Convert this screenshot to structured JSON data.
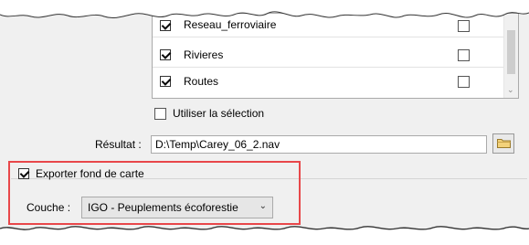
{
  "layers": {
    "items": [
      {
        "label": "Reseau_ferroviaire",
        "visible": true,
        "extra": false
      },
      {
        "label": "Rivieres",
        "visible": true,
        "extra": false
      },
      {
        "label": "Routes",
        "visible": true,
        "extra": false
      }
    ]
  },
  "use_selection": {
    "label": "Utiliser la sélection",
    "checked": false
  },
  "result": {
    "label": "Résultat :",
    "value": "D:\\Temp\\Carey_06_2.nav"
  },
  "export": {
    "label": "Exporter fond de carte",
    "checked": true,
    "layer_label": "Couche :",
    "layer_value": "IGO - Peuplements écoforestie"
  },
  "icons": {
    "browse": "folder-icon",
    "dropdown": "chevron-down-icon"
  },
  "colors": {
    "highlight": "#e8474a"
  }
}
